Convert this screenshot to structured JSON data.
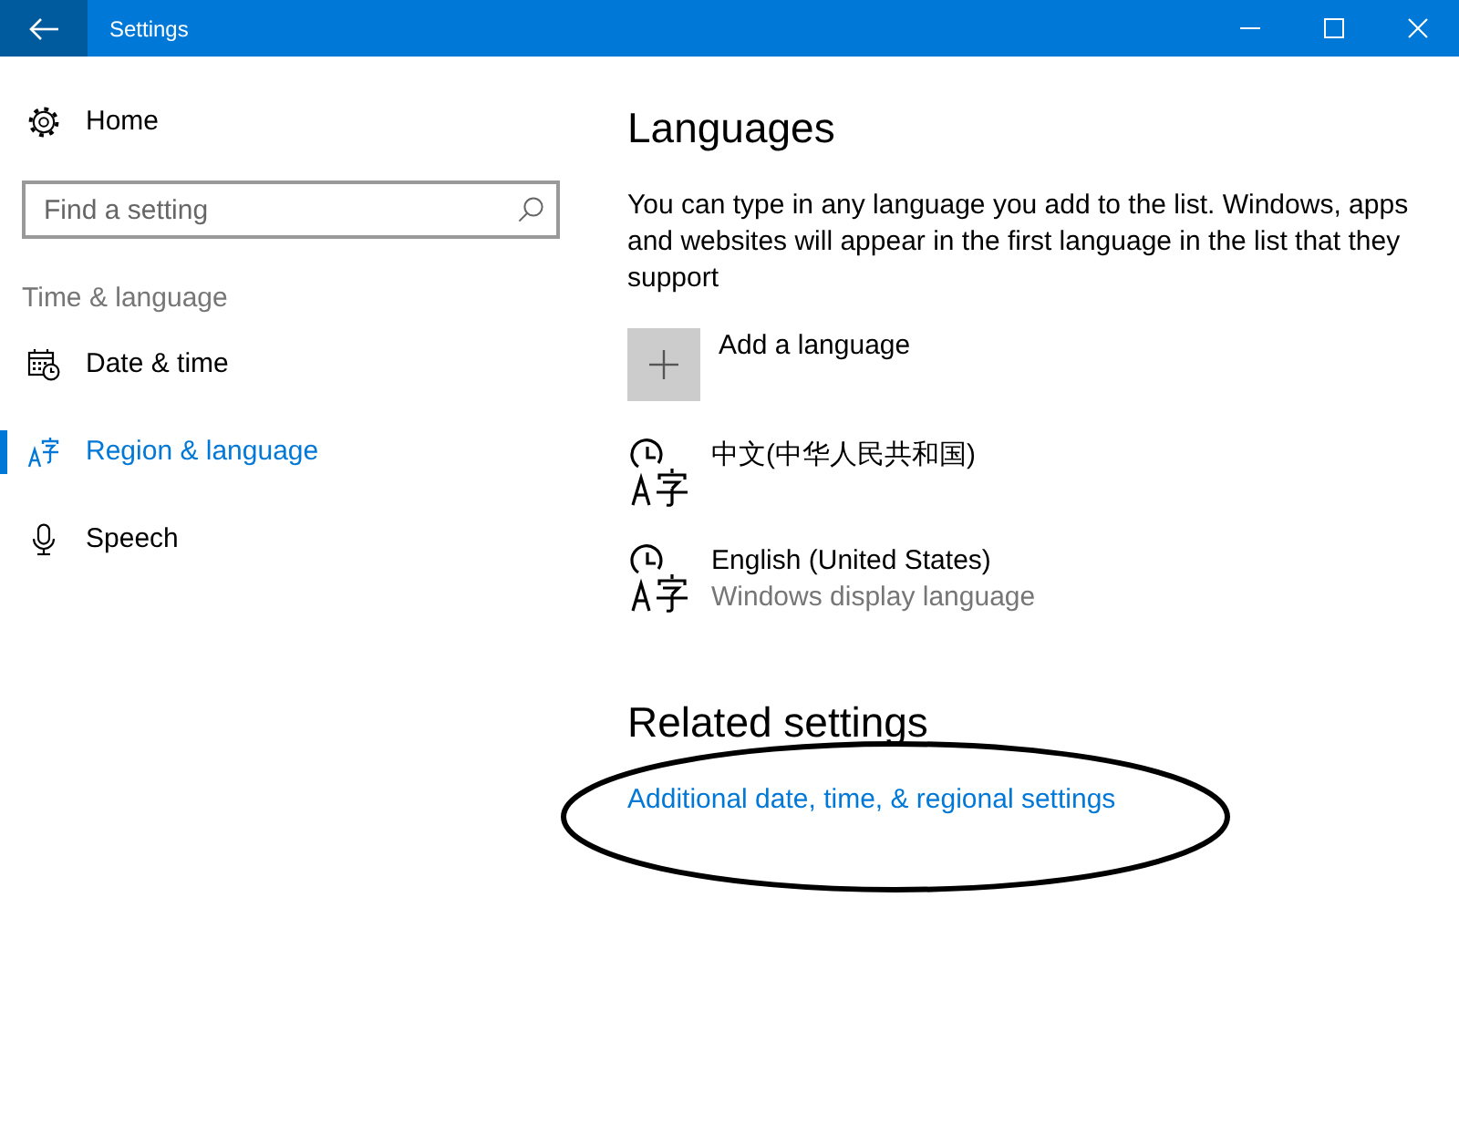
{
  "window": {
    "title": "Settings"
  },
  "sidebar": {
    "home": "Home",
    "search": {
      "placeholder": "Find a setting"
    },
    "section": "Time & language",
    "items": [
      {
        "label": "Date & time",
        "kind": "calendar",
        "selected": false
      },
      {
        "label": "Region & language",
        "kind": "language",
        "selected": true
      },
      {
        "label": "Speech",
        "kind": "microphone",
        "selected": false
      }
    ]
  },
  "content": {
    "title": "Languages",
    "description": "You can type in any language you add to the list. Windows, apps and websites will appear in the first language in the list that they support",
    "add_button": "Add a language",
    "languages": [
      {
        "name": "中文(中华人民共和国)"
      },
      {
        "name": "English (United States)",
        "subtitle": "Windows display language"
      }
    ]
  },
  "related": {
    "title": "Related settings",
    "links": [
      {
        "label": "Additional date, time, & regional settings",
        "circled": true
      }
    ]
  }
}
